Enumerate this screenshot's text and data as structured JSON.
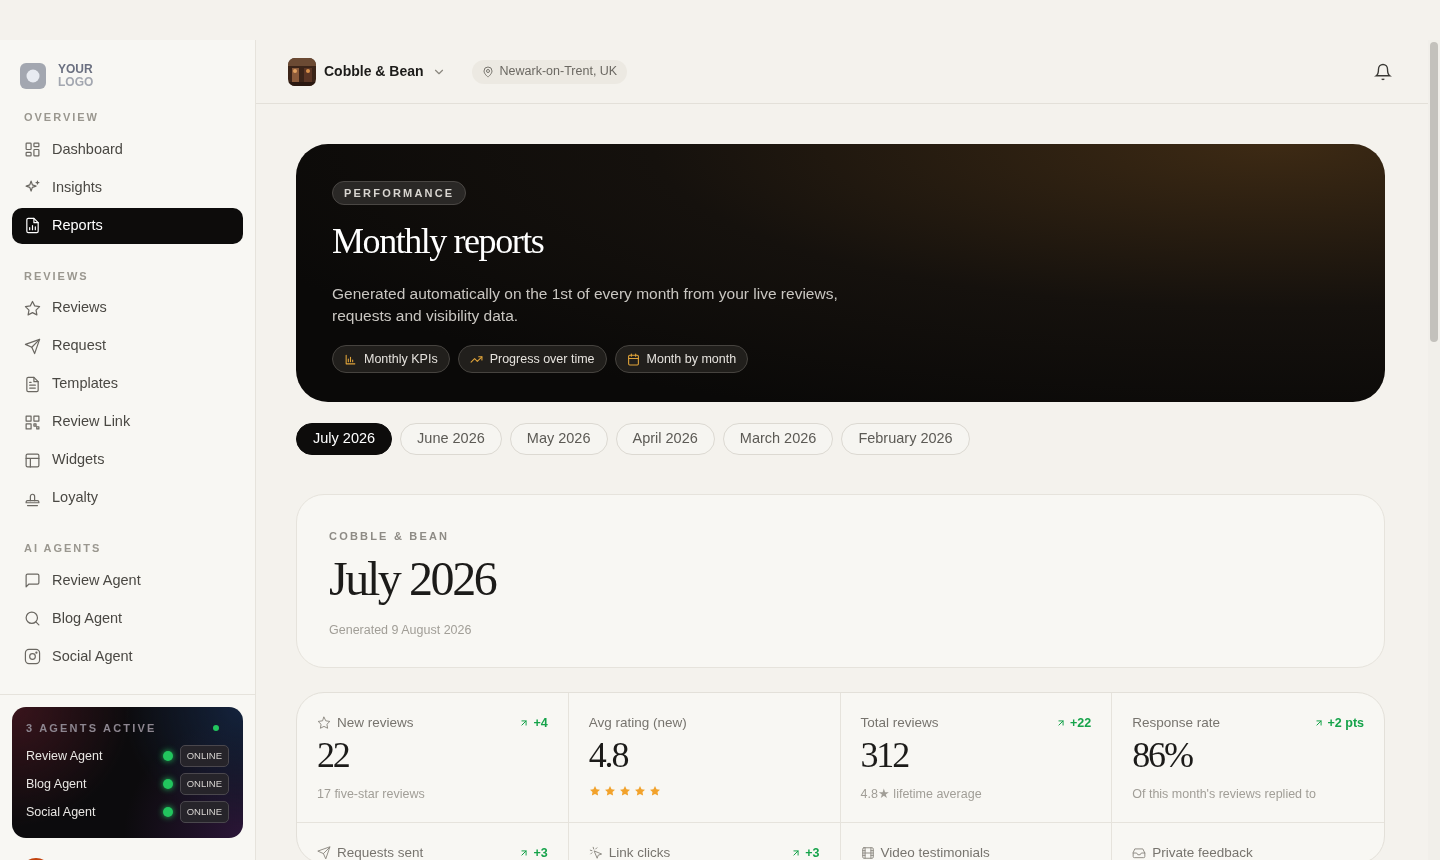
{
  "sidebar": {
    "logo": {
      "line_1": "YOUR",
      "line_2": "LOGO"
    },
    "sections": [
      {
        "heading": "OVERVIEW",
        "items": [
          {
            "label": "Dashboard",
            "selected": false
          },
          {
            "label": "Insights",
            "selected": false
          },
          {
            "label": "Reports",
            "selected": true
          }
        ]
      },
      {
        "heading": "REVIEWS",
        "items": [
          {
            "label": "Reviews",
            "selected": false
          },
          {
            "label": "Request",
            "selected": false
          },
          {
            "label": "Templates",
            "selected": false
          },
          {
            "label": "Review Link",
            "selected": false
          },
          {
            "label": "Widgets",
            "selected": false
          },
          {
            "label": "Loyalty",
            "selected": false
          }
        ]
      },
      {
        "heading": "AI AGENTS",
        "items": [
          {
            "label": "Review Agent",
            "selected": false
          },
          {
            "label": "Blog Agent",
            "selected": false
          },
          {
            "label": "Social Agent",
            "selected": false
          }
        ]
      }
    ],
    "agents_card": {
      "title": "3 AGENTS ACTIVE",
      "agents": [
        {
          "name": "Review Agent",
          "status": "ONLINE"
        },
        {
          "name": "Blog Agent",
          "status": "ONLINE"
        },
        {
          "name": "Social Agent",
          "status": "ONLINE"
        }
      ]
    }
  },
  "header": {
    "business": "Cobble & Bean",
    "location": "Newark-on-Trent, UK"
  },
  "hero": {
    "badge": "PERFORMANCE",
    "title": "Monthly reports",
    "description": "Generated automatically on the 1st of every month from your live reviews, requests and visibility data.",
    "chips": [
      "Monthly KPIs",
      "Progress over time",
      "Month by month"
    ]
  },
  "month_tabs": [
    {
      "label": "July 2026",
      "selected": true
    },
    {
      "label": "June 2026",
      "selected": false
    },
    {
      "label": "May 2026",
      "selected": false
    },
    {
      "label": "April 2026",
      "selected": false
    },
    {
      "label": "March 2026",
      "selected": false
    },
    {
      "label": "February 2026",
      "selected": false
    }
  ],
  "report": {
    "business": "COBBLE & BEAN",
    "month": "July 2026",
    "generated": "Generated 9 August 2026"
  },
  "kpis": [
    {
      "label": "New reviews",
      "delta": "+4",
      "value": "22",
      "sub": "17 five-star reviews"
    },
    {
      "label": "Avg rating (new)",
      "value": "4.8",
      "stars": 5
    },
    {
      "label": "Total reviews",
      "delta": "+22",
      "value": "312",
      "sub": "4.8★ lifetime average"
    },
    {
      "label": "Response rate",
      "delta": "+2 pts",
      "value": "86%",
      "sub": "Of this month's reviews replied to"
    },
    {
      "label": "Requests sent",
      "delta": "+3"
    },
    {
      "label": "Link clicks",
      "delta": "+3"
    },
    {
      "label": "Video testimonials"
    },
    {
      "label": "Private feedback"
    }
  ]
}
